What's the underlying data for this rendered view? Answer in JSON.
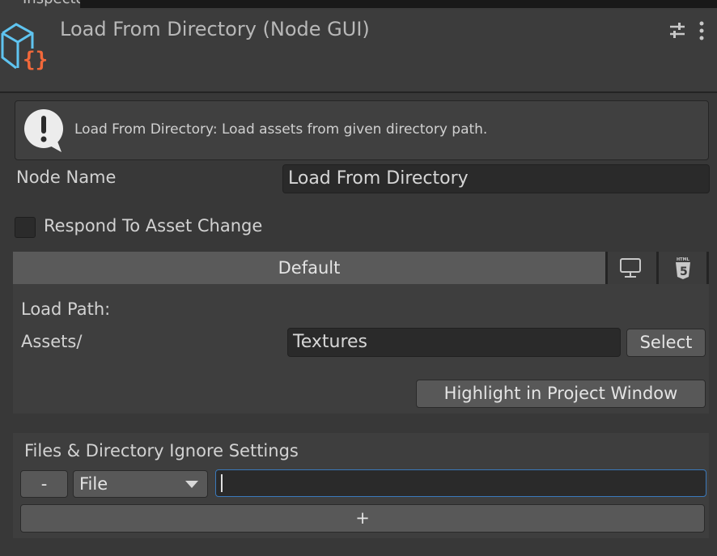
{
  "window": {
    "tab_label": "Inspector"
  },
  "header": {
    "title": "Load From Directory (Node GUI)",
    "icon": "cube-braces-icon"
  },
  "help": {
    "message": "Load From Directory: Load assets from given directory path."
  },
  "node_name": {
    "label": "Node Name",
    "value": "Load From Directory"
  },
  "respond": {
    "label": "Respond To Asset Change",
    "checked": false
  },
  "platform_tabs": {
    "default_label": "Default",
    "icons": [
      "monitor-icon",
      "html5-icon"
    ]
  },
  "load_path": {
    "label": "Load Path:",
    "prefix": "Assets/",
    "value": "Textures",
    "select_label": "Select",
    "highlight_label": "Highlight in Project Window"
  },
  "ignore": {
    "title": "Files & Directory Ignore Settings",
    "remove_label": "-",
    "type_value": "File",
    "pattern_value": "",
    "add_label": "+"
  }
}
